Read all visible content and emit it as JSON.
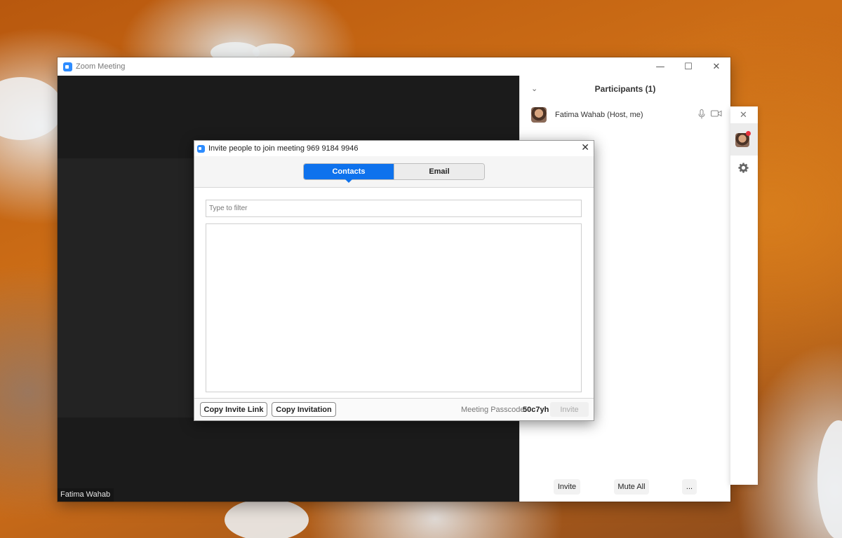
{
  "window": {
    "title": "Zoom Meeting",
    "minimize": "—",
    "maximize": "☐",
    "close": "✕"
  },
  "video": {
    "name_tag": "Fatima Wahab"
  },
  "participants": {
    "title": "Participants (1)",
    "collapse": "⌄",
    "items": [
      {
        "name": "Fatima Wahab (Host, me)"
      }
    ],
    "footer": {
      "invite": "Invite",
      "mute_all": "Mute All",
      "more": "..."
    }
  },
  "side_panel": {
    "close": "✕"
  },
  "dialog": {
    "title": "Invite people to join meeting 969 9184 9946",
    "close": "✕",
    "tabs": [
      {
        "label": "Contacts",
        "active": true
      },
      {
        "label": "Email",
        "active": false
      }
    ],
    "filter_placeholder": "Type to filter",
    "copy_link": "Copy Invite Link",
    "copy_invitation": "Copy Invitation",
    "passcode_label": "Meeting Passcode:",
    "passcode_value": "50c7yh",
    "invite": "Invite"
  },
  "colors": {
    "zoom_blue": "#0e72ed",
    "logo_blue": "#2d8cff",
    "notification_red": "#e8323c"
  }
}
